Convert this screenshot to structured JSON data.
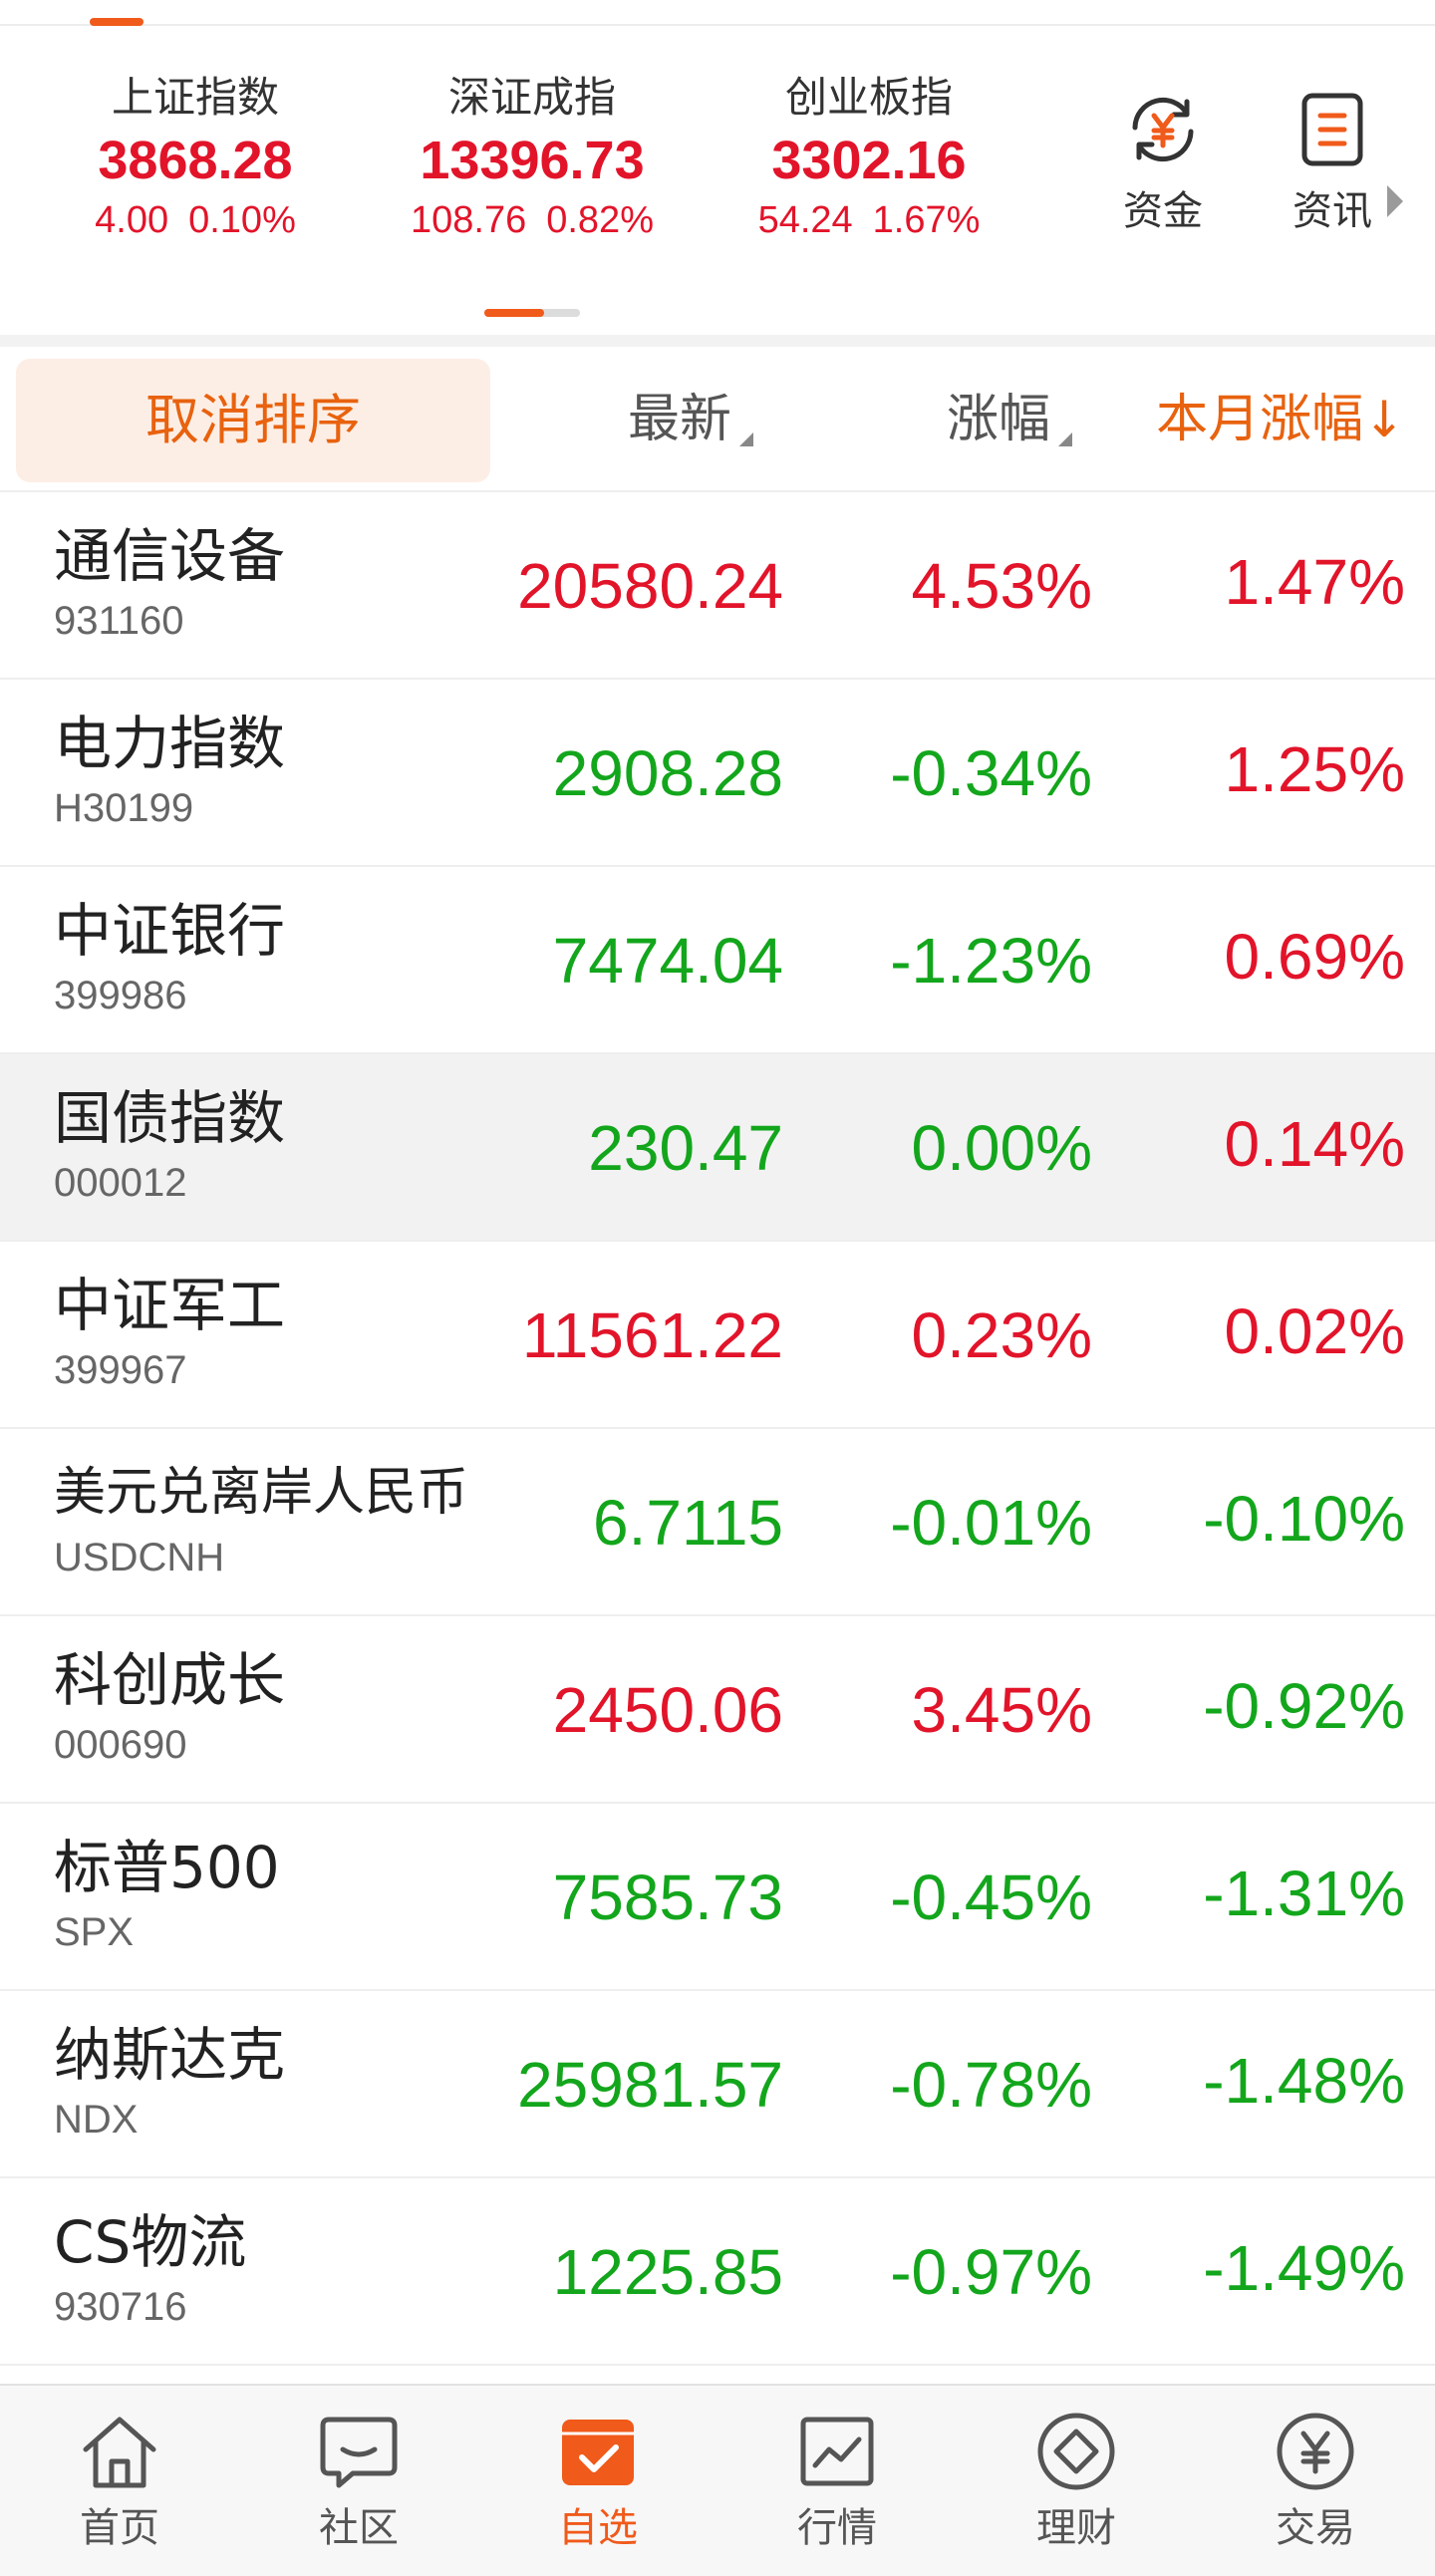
{
  "colors": {
    "accent": "#f05a1a",
    "up": "#e2142a",
    "down": "#13a61c"
  },
  "indices": [
    {
      "name": "上证指数",
      "value": "3868.28",
      "change": "4.00",
      "pct": "0.10%"
    },
    {
      "name": "深证成指",
      "value": "13396.73",
      "change": "108.76",
      "pct": "0.82%"
    },
    {
      "name": "创业板指",
      "value": "3302.16",
      "change": "54.24",
      "pct": "1.67%"
    }
  ],
  "quick": [
    {
      "label": "资金",
      "icon": "yen-exchange-icon"
    },
    {
      "label": "资讯",
      "icon": "news-icon"
    }
  ],
  "sort": {
    "cancel_label": "取消排序",
    "latest_label": "最新",
    "change_label": "涨幅",
    "month_label": "本月涨幅",
    "month_arrow": "↓"
  },
  "rows": [
    {
      "name": "通信设备",
      "code": "931160",
      "latest": "20580.24",
      "change": "4.53%",
      "month": "1.47%"
    },
    {
      "name": "电力指数",
      "code": "H30199",
      "latest": "2908.28",
      "change": "-0.34%",
      "month": "1.25%"
    },
    {
      "name": "中证银行",
      "code": "399986",
      "latest": "7474.04",
      "change": "-1.23%",
      "month": "0.69%"
    },
    {
      "name": "国债指数",
      "code": "000012",
      "latest": "230.47",
      "change": "0.00%",
      "month": "0.14%"
    },
    {
      "name": "中证军工",
      "code": "399967",
      "latest": "11561.22",
      "change": "0.23%",
      "month": "0.02%"
    },
    {
      "name": "美元兑离岸人民币",
      "code": "USDCNH",
      "latest": "6.7115",
      "change": "-0.01%",
      "month": "-0.10%"
    },
    {
      "name": "科创成长",
      "code": "000690",
      "latest": "2450.06",
      "change": "3.45%",
      "month": "-0.92%"
    },
    {
      "name": "标普500",
      "code": "SPX",
      "latest": "7585.73",
      "change": "-0.45%",
      "month": "-1.31%"
    },
    {
      "name": "纳斯达克",
      "code": "NDX",
      "latest": "25981.57",
      "change": "-0.78%",
      "month": "-1.48%"
    },
    {
      "name": "CS物流",
      "code": "930716",
      "latest": "1225.85",
      "change": "-0.97%",
      "month": "-1.49%"
    }
  ],
  "tabs": [
    {
      "label": "首页",
      "icon": "home-icon"
    },
    {
      "label": "社区",
      "icon": "chat-icon"
    },
    {
      "label": "自选",
      "icon": "watchlist-icon"
    },
    {
      "label": "行情",
      "icon": "chart-icon"
    },
    {
      "label": "理财",
      "icon": "diamond-icon"
    },
    {
      "label": "交易",
      "icon": "yen-icon"
    }
  ]
}
